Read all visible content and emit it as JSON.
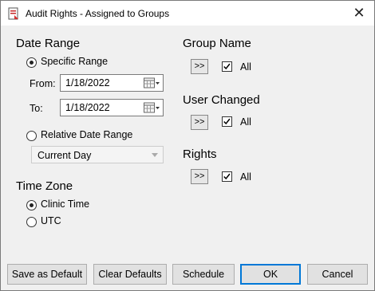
{
  "window": {
    "title": "Audit Rights - Assigned to Groups",
    "close_glyph": "✕"
  },
  "date_range": {
    "heading": "Date Range",
    "specific_label": "Specific Range",
    "from_label": "From:",
    "from_value": "1/18/2022",
    "to_label": "To:",
    "to_value": "1/18/2022",
    "relative_label": "Relative Date Range",
    "relative_value": "Current Day",
    "selected": "specific"
  },
  "time_zone": {
    "heading": "Time Zone",
    "options": [
      "Clinic Time",
      "UTC"
    ],
    "selected": "Clinic Time"
  },
  "filters": [
    {
      "heading": "Group Name",
      "button": ">>",
      "all_label": "All",
      "checked": true
    },
    {
      "heading": "User Changed",
      "button": ">>",
      "all_label": "All",
      "checked": true
    },
    {
      "heading": "Rights",
      "button": ">>",
      "all_label": "All",
      "checked": true
    }
  ],
  "buttons": {
    "save_default": "Save as Default",
    "clear_defaults": "Clear Defaults",
    "schedule": "Schedule",
    "ok": "OK",
    "cancel": "Cancel"
  },
  "colors": {
    "accent": "#0078d7",
    "background": "#f0f0f0",
    "titlebar": "#ffffff"
  }
}
